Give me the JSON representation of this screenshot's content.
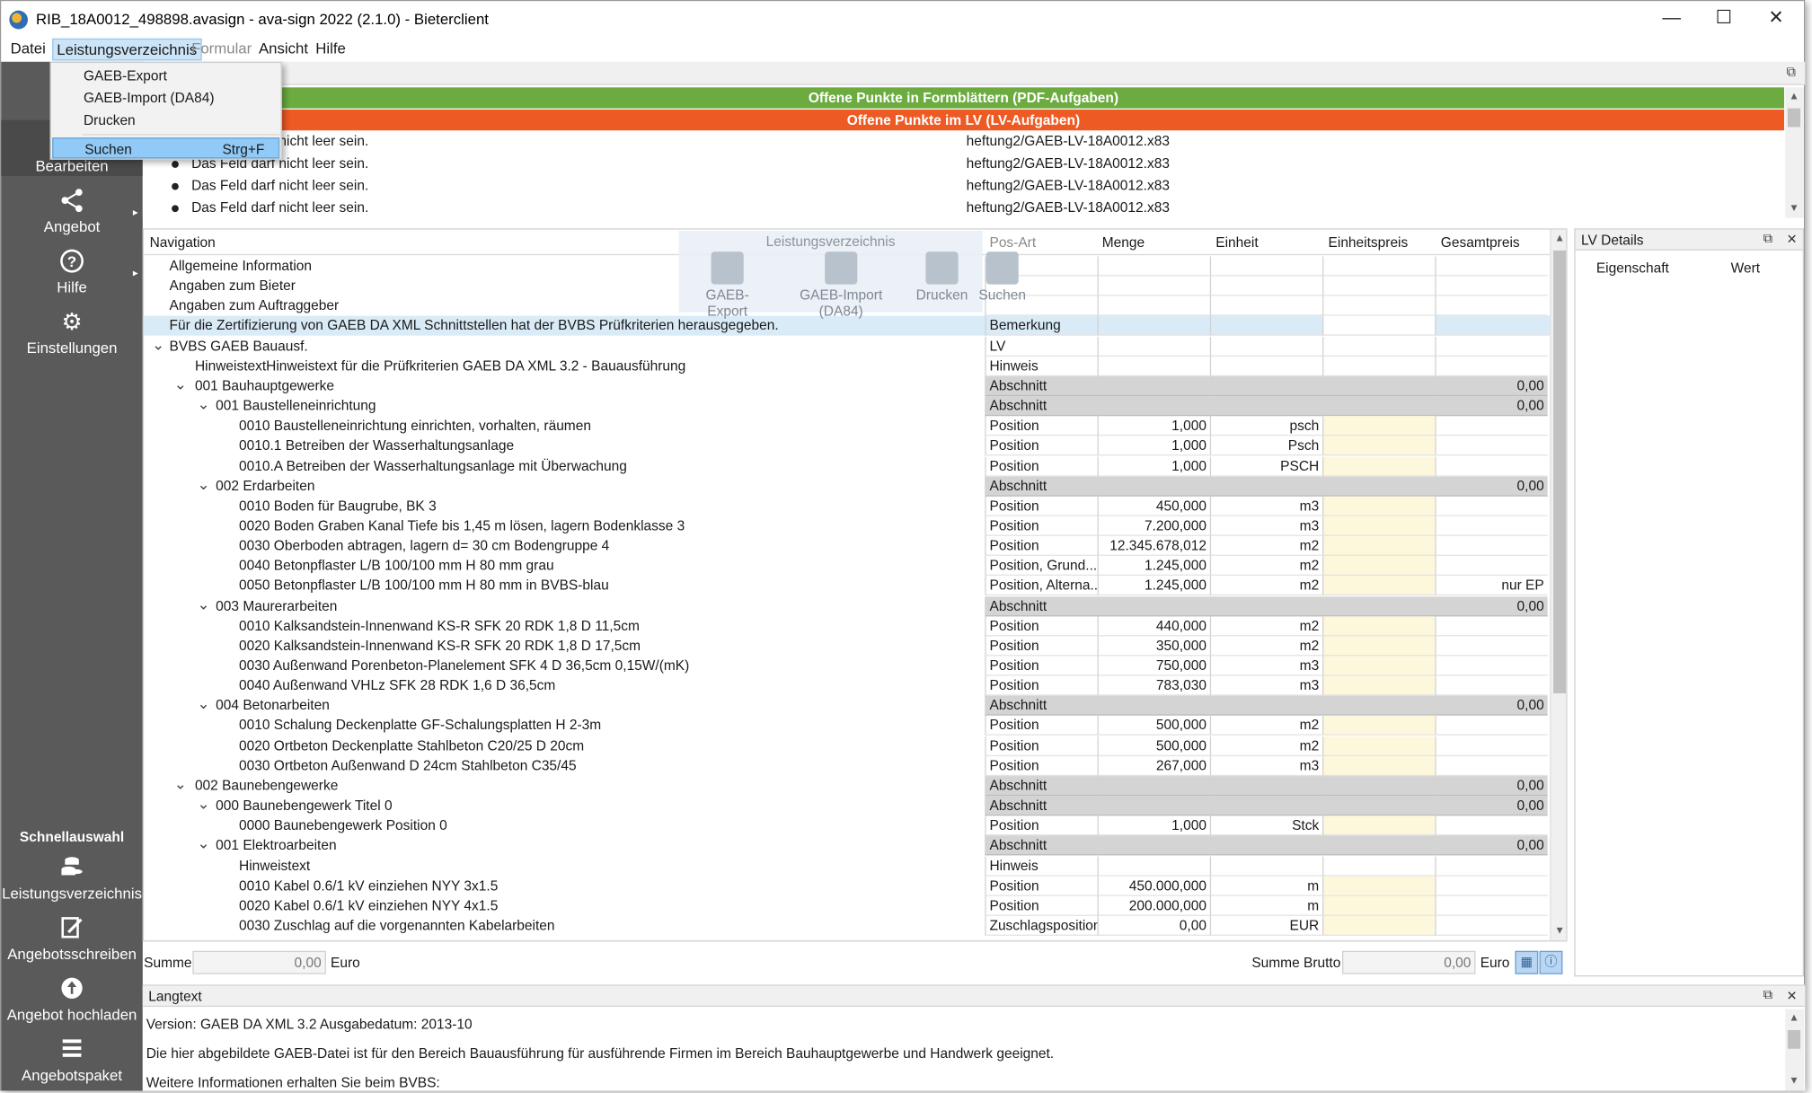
{
  "window": {
    "title": "RIB_18A0012_498898.avasign - ava-sign 2022 (2.1.0) - Bieterclient",
    "controls": {
      "minimize": "—",
      "maximize": "☐",
      "close": "✕"
    }
  },
  "menu": {
    "items": [
      "Datei",
      "Leistungsverzeichnis",
      "Formular",
      "Ansicht",
      "Hilfe"
    ],
    "active": "Leistungsverzeichnis",
    "dropdown": {
      "items": [
        "GAEB-Export",
        "GAEB-Import (DA84)",
        "Drucken",
        "Suchen"
      ],
      "selected": "Suchen",
      "shortcut": "Strg+F"
    }
  },
  "sidebar": {
    "items": [
      "Bearbeiten",
      "Angebot",
      "Hilfe",
      "Einstellungen"
    ],
    "quick_header": "Schnellauswahl",
    "quick_items": [
      "Leistungsverzeichnis",
      "Angebotsschreiben",
      "Angebot hochladen",
      "Angebotspaket"
    ]
  },
  "banners": {
    "formblatt": "Offene Punkte in Formblättern (PDF-Aufgaben)",
    "lv": "Offene Punkte im LV (LV-Aufgaben)",
    "colors": {
      "green": "#6cab3f",
      "orange": "#ee5a24"
    }
  },
  "messages": [
    {
      "text": "Das Feld darf nicht leer sein.",
      "file": "heftung2/GAEB-LV-18A0012.x83"
    },
    {
      "text": "Das Feld darf nicht leer sein.",
      "file": "heftung2/GAEB-LV-18A0012.x83"
    },
    {
      "text": "Das Feld darf nicht leer sein.",
      "file": "heftung2/GAEB-LV-18A0012.x83"
    },
    {
      "text": "Das Feld darf nicht leer sein.",
      "file": "heftung2/GAEB-LV-18A0012.x83"
    }
  ],
  "toolbar": {
    "title": "Leistungsverzeichnis",
    "buttons": [
      "GAEB-Export",
      "GAEB-Import (DA84)",
      "Drucken",
      "Suchen"
    ]
  },
  "table": {
    "headers": {
      "nav": "Navigation",
      "posart": "Pos-Art",
      "menge": "Menge",
      "einheit": "Einheit",
      "ep": "Einheitspreis",
      "gp": "Gesamtpreis"
    },
    "rows": [
      {
        "label": "Allgemeine Information",
        "level": 0,
        "posart": "",
        "menge": "",
        "einheit": "",
        "gp": ""
      },
      {
        "label": "Angaben zum Bieter",
        "level": 0,
        "posart": "",
        "menge": "",
        "einheit": "",
        "gp": ""
      },
      {
        "label": "Angaben zum Auftraggeber",
        "level": 0,
        "posart": "",
        "menge": "",
        "einheit": "",
        "gp": ""
      },
      {
        "label": "Für die Zertifizierung von GAEB DA XML Schnittstellen hat der BVBS Prüfkriterien herausgegeben.",
        "level": 0,
        "posart": "Bemerkung",
        "menge": "",
        "einheit": "",
        "gp": "",
        "hl": true
      },
      {
        "label": "BVBS GAEB Bauausf.",
        "level": 0,
        "chev": true,
        "posart": "LV",
        "menge": "",
        "einheit": "",
        "gp": ""
      },
      {
        "label": "HinweistextHinweistext für die Prüfkriterien GAEB DA XML 3.2 - Bauausführung",
        "level": 1,
        "posart": "Hinweis",
        "menge": "",
        "einheit": "",
        "gp": ""
      },
      {
        "label": "001 Bauhauptgewerke",
        "level": 1,
        "chev": true,
        "posart": "Abschnitt",
        "menge": "",
        "einheit": "",
        "gp": "0,00",
        "sec": true
      },
      {
        "label": "001 Baustelleneinrichtung",
        "level": 2,
        "chev": true,
        "posart": "Abschnitt",
        "menge": "",
        "einheit": "",
        "gp": "0,00",
        "sec": true
      },
      {
        "label": "0010 Baustelleneinrichtung einrichten, vorhalten, räumen",
        "level": 3,
        "posart": "Position",
        "menge": "1,000",
        "einheit": "psch",
        "gp": ""
      },
      {
        "label": "0010.1 Betreiben der Wasserhaltungsanlage",
        "level": 3,
        "posart": "Position",
        "menge": "1,000",
        "einheit": "Psch",
        "gp": ""
      },
      {
        "label": "0010.A Betreiben der Wasserhaltungsanlage mit Überwachung",
        "level": 3,
        "posart": "Position",
        "menge": "1,000",
        "einheit": "PSCH",
        "gp": ""
      },
      {
        "label": "002 Erdarbeiten",
        "level": 2,
        "chev": true,
        "posart": "Abschnitt",
        "menge": "",
        "einheit": "",
        "gp": "0,00",
        "sec": true
      },
      {
        "label": "0010 Boden für Baugrube, BK 3",
        "level": 3,
        "posart": "Position",
        "menge": "450,000",
        "einheit": "m3",
        "gp": ""
      },
      {
        "label": "0020 Boden Graben Kanal Tiefe bis 1,45 m lösen, lagern Bodenklasse 3",
        "level": 3,
        "posart": "Position",
        "menge": "7.200,000",
        "einheit": "m3",
        "gp": ""
      },
      {
        "label": "0030 Oberboden abtragen, lagern d= 30 cm Bodengruppe 4",
        "level": 3,
        "posart": "Position",
        "menge": "12.345.678,012",
        "einheit": "m2",
        "gp": ""
      },
      {
        "label": "0040 Betonpflaster L/B 100/100 mm H 80 mm grau",
        "level": 3,
        "posart": "Position, Grund...",
        "menge": "1.245,000",
        "einheit": "m2",
        "gp": ""
      },
      {
        "label": "0050 Betonpflaster L/B 100/100 mm H 80 mm in BVBS-blau",
        "level": 3,
        "posart": "Position, Alterna...",
        "menge": "1.245,000",
        "einheit": "m2",
        "gp": "nur EP"
      },
      {
        "label": "003 Maurerarbeiten",
        "level": 2,
        "chev": true,
        "posart": "Abschnitt",
        "menge": "",
        "einheit": "",
        "gp": "0,00",
        "sec": true
      },
      {
        "label": "0010 Kalksandstein-Innenwand KS-R SFK 20 RDK 1,8 D 11,5cm",
        "level": 3,
        "posart": "Position",
        "menge": "440,000",
        "einheit": "m2",
        "gp": ""
      },
      {
        "label": "0020 Kalksandstein-Innenwand KS-R SFK 20 RDK 1,8 D 17,5cm",
        "level": 3,
        "posart": "Position",
        "menge": "350,000",
        "einheit": "m2",
        "gp": ""
      },
      {
        "label": "0030 Außenwand Porenbeton-Planelement SFK 4 D 36,5cm 0,15W/(mK)",
        "level": 3,
        "posart": "Position",
        "menge": "750,000",
        "einheit": "m3",
        "gp": ""
      },
      {
        "label": "0040 Außenwand VHLz SFK 28 RDK 1,6 D 36,5cm",
        "level": 3,
        "posart": "Position",
        "menge": "783,030",
        "einheit": "m3",
        "gp": ""
      },
      {
        "label": "004 Betonarbeiten",
        "level": 2,
        "chev": true,
        "posart": "Abschnitt",
        "menge": "",
        "einheit": "",
        "gp": "0,00",
        "sec": true
      },
      {
        "label": "0010 Schalung Deckenplatte GF-Schalungsplatten H 2-3m",
        "level": 3,
        "posart": "Position",
        "menge": "500,000",
        "einheit": "m2",
        "gp": ""
      },
      {
        "label": "0020 Ortbeton Deckenplatte Stahlbeton C20/25 D 20cm",
        "level": 3,
        "posart": "Position",
        "menge": "500,000",
        "einheit": "m2",
        "gp": ""
      },
      {
        "label": "0030 Ortbeton Außenwand D 24cm Stahlbeton C35/45",
        "level": 3,
        "posart": "Position",
        "menge": "267,000",
        "einheit": "m3",
        "gp": ""
      },
      {
        "label": "002 Baunebengewerke",
        "level": 1,
        "chev": true,
        "posart": "Abschnitt",
        "menge": "",
        "einheit": "",
        "gp": "0,00",
        "sec": true
      },
      {
        "label": "000 Baunebengewerk Titel 0",
        "level": 2,
        "chev": true,
        "posart": "Abschnitt",
        "menge": "",
        "einheit": "",
        "gp": "0,00",
        "sec": true
      },
      {
        "label": "0000 Baunebengewerk Position 0",
        "level": 3,
        "posart": "Position",
        "menge": "1,000",
        "einheit": "Stck",
        "gp": ""
      },
      {
        "label": "001 Elektroarbeiten",
        "level": 2,
        "chev": true,
        "posart": "Abschnitt",
        "menge": "",
        "einheit": "",
        "gp": "0,00",
        "sec": true
      },
      {
        "label": "Hinweistext",
        "level": 3,
        "posart": "Hinweis",
        "menge": "",
        "einheit": "",
        "gp": ""
      },
      {
        "label": "0010 Kabel 0.6/1 kV einziehen NYY 3x1.5",
        "level": 3,
        "posart": "Position",
        "menge": "450.000,000",
        "einheit": "m",
        "gp": ""
      },
      {
        "label": "0020 Kabel 0.6/1 kV einziehen NYY 4x1.5",
        "level": 3,
        "posart": "Position",
        "menge": "200.000,000",
        "einheit": "m",
        "gp": ""
      },
      {
        "label": "0030 Zuschlag auf die vorgenannten Kabelarbeiten",
        "level": 3,
        "posart": "Zuschlagsposition",
        "menge": "0,00",
        "einheit": "EUR",
        "gp": ""
      }
    ]
  },
  "summary": {
    "summe_label": "Summe",
    "summe_value": "0,00",
    "euro": "Euro",
    "brutto_label": "Summe Brutto",
    "brutto_value": "0,00"
  },
  "lv_details": {
    "title": "LV Details",
    "col1": "Eigenschaft",
    "col2": "Wert"
  },
  "langtext": {
    "title": "Langtext",
    "lines": [
      "Version: GAEB DA XML 3.2 Ausgabedatum: 2013-10",
      "Die hier abgebildete GAEB-Datei ist für den Bereich Bauausführung für ausführende Firmen im Bereich Bauhauptgewerbe und Handwerk geeignet.",
      "Weitere Informationen erhalten Sie beim BVBS:"
    ]
  }
}
